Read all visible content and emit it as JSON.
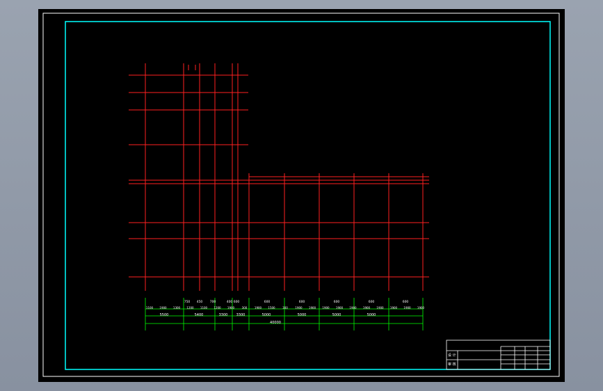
{
  "plan": {
    "dims_row_bottom": [
      {
        "label": "5500"
      },
      {
        "label": "5400"
      },
      {
        "label": "3300"
      },
      {
        "label": "3300"
      },
      {
        "label": "5000"
      },
      {
        "label": "5000"
      },
      {
        "label": "5000"
      },
      {
        "label": "5000"
      }
    ],
    "dims_row_mid": [
      {
        "label": "1100"
      },
      {
        "label": "1900"
      },
      {
        "label": "1300"
      },
      {
        "label": "1200"
      },
      {
        "label": "1100"
      },
      {
        "label": "1200"
      },
      {
        "label": "1900"
      },
      {
        "label": "300"
      },
      {
        "label": "1900"
      },
      {
        "label": "1500"
      },
      {
        "label": "300"
      },
      {
        "label": "1900"
      },
      {
        "label": "1900"
      },
      {
        "label": "1900"
      },
      {
        "label": "1900"
      },
      {
        "label": "1900"
      },
      {
        "label": "1900"
      },
      {
        "label": "1900"
      },
      {
        "label": "1900"
      },
      {
        "label": "1900"
      },
      {
        "label": "1900"
      }
    ],
    "dims_row_top": [
      {
        "label": "750"
      },
      {
        "label": "450"
      },
      {
        "label": "700"
      },
      {
        "label": "400"
      },
      {
        "label": "600"
      },
      {
        "label": "600"
      },
      {
        "label": "600"
      },
      {
        "label": "600"
      },
      {
        "label": "600"
      },
      {
        "label": "600"
      }
    ],
    "dim_total": "40000"
  },
  "title_block": {
    "row1": "",
    "left_labels": [
      "设 计",
      "审 核"
    ]
  }
}
